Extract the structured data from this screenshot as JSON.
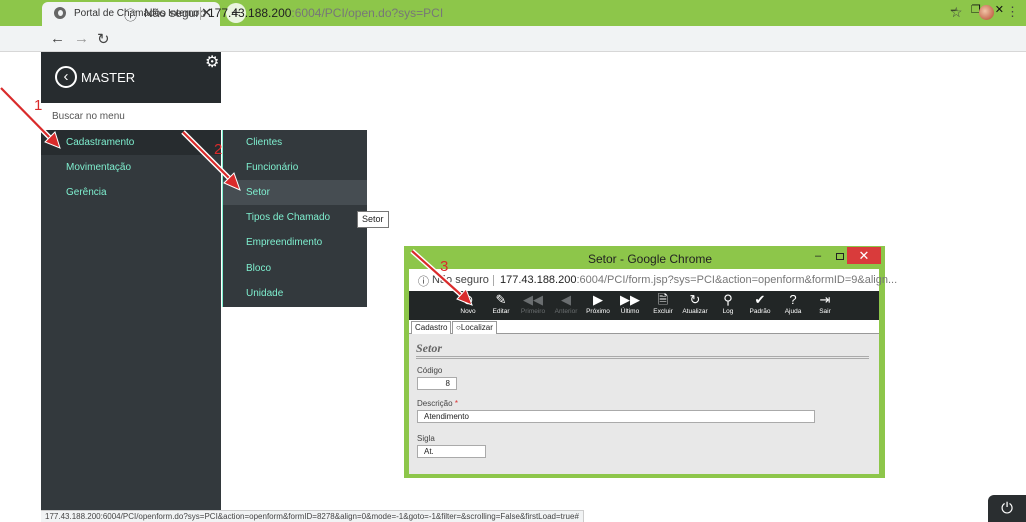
{
  "browser": {
    "tab_title": "Portal de Chamados Interno",
    "tab_close": "✕",
    "new_tab": "+",
    "window_controls": "–❐✕",
    "back": "←",
    "forward": "→",
    "reload": "↻",
    "info_icon": "ⓘ",
    "security_label": "Não seguro",
    "url_host": "177.43.188.200",
    "url_rest": ":6004/PCI/open.do?sys=PCI",
    "star": "☆",
    "menu": "⋮",
    "status_url": "177.43.188.200:6004/PCI/openform.do?sys=PCI&action=openform&formID=8278&align=0&mode=-1&goto=-1&filter=&scrolling=False&firstLoad=true#"
  },
  "sidebar": {
    "back": "‹",
    "title": "MASTER",
    "gear": "⚙",
    "search_placeholder": "Buscar no menu",
    "items": [
      "Cadastramento",
      "Movimentação",
      "Gerência"
    ]
  },
  "submenu": {
    "items": [
      "Clientes",
      "Funcionário",
      "Setor",
      "Tipos de Chamado",
      "Empreendimento",
      "Bloco",
      "Unidade"
    ],
    "tooltip": "Setor"
  },
  "annotations": [
    "1",
    "2",
    "3"
  ],
  "popup": {
    "title": "Setor - Google Chrome",
    "minimize": "–",
    "close": "✕",
    "info_icon": "ⓘ",
    "security_label": "Não seguro",
    "url_host": "177.43.188.200",
    "url_rest": ":6004/PCI/form.jsp?sys=PCI&action=openform&formID=9&align...",
    "toolbar": [
      {
        "label": "Novo",
        "icon": "⊕",
        "enabled": true
      },
      {
        "label": "Editar",
        "icon": "✎",
        "enabled": true
      },
      {
        "label": "Primeiro",
        "icon": "◀◀",
        "enabled": false
      },
      {
        "label": "Anterior",
        "icon": "◀",
        "enabled": false
      },
      {
        "label": "Próximo",
        "icon": "▶",
        "enabled": true
      },
      {
        "label": "Último",
        "icon": "▶▶",
        "enabled": true
      },
      {
        "label": "Excluir",
        "icon": "🗎",
        "enabled": true
      },
      {
        "label": "Atualizar",
        "icon": "↻",
        "enabled": true
      },
      {
        "label": "Log",
        "icon": "⚲",
        "enabled": true
      },
      {
        "label": "Padrão",
        "icon": "✔",
        "enabled": true
      },
      {
        "label": "Ajuda",
        "icon": "?",
        "enabled": true
      },
      {
        "label": "Sair",
        "icon": "⇥",
        "enabled": true
      }
    ],
    "tabs": [
      "Cadastro",
      "Localizar"
    ],
    "search_icon": "○",
    "form_title": "Setor",
    "fields": {
      "codigo_label": "Código",
      "codigo_value": "8",
      "descricao_label": "Descrição",
      "required_mark": "*",
      "descricao_value": "Atendimento",
      "sigla_label": "Sigla",
      "sigla_value": "At."
    }
  },
  "power_icon": "⏻",
  "colors": {
    "chrome_green": "#8dc64a",
    "sidebar_bg": "#33393d",
    "menu_text": "#7ff0d0",
    "annotation_red": "#d92b2b"
  }
}
